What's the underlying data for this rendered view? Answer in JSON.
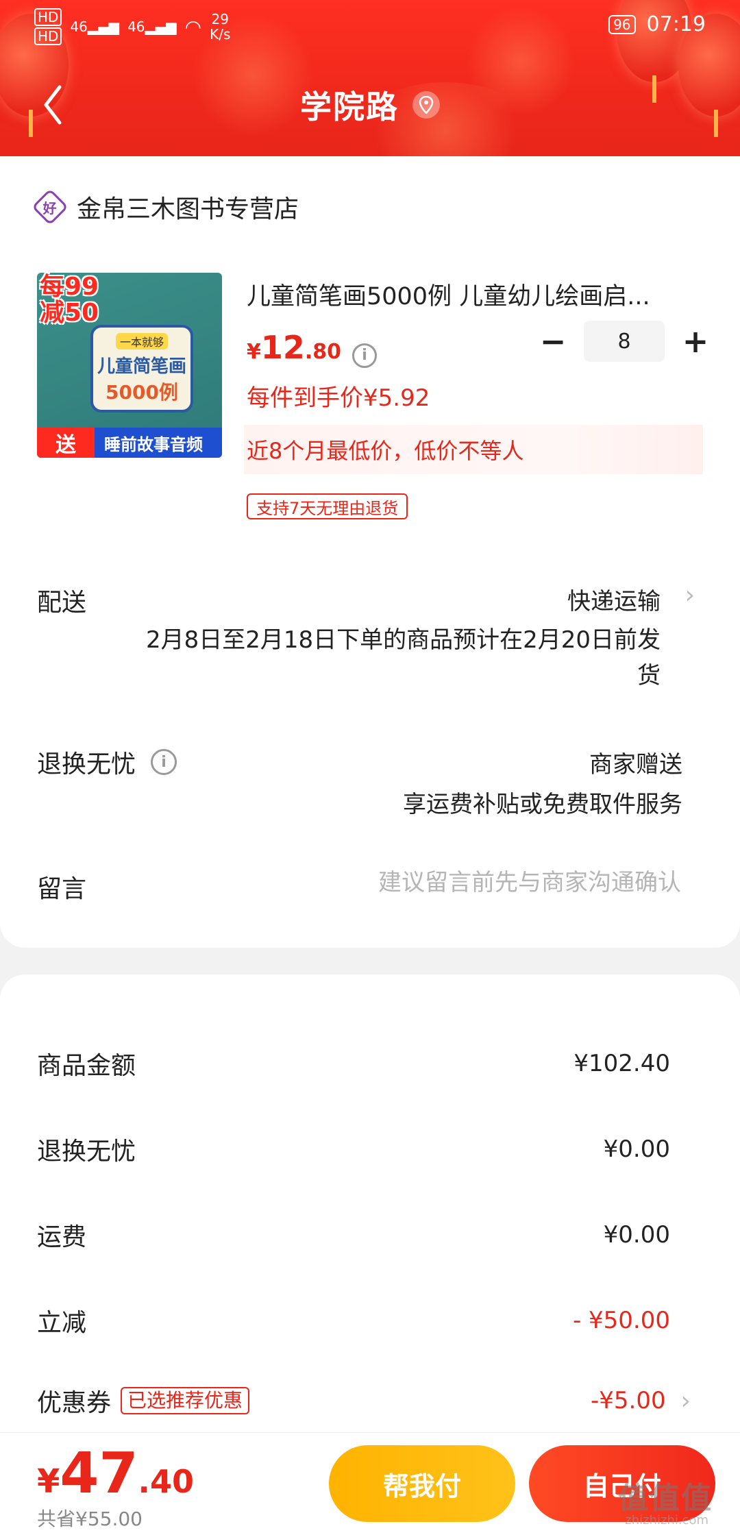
{
  "status_bar": {
    "hd1": "HD",
    "hd2": "HD",
    "signal1": "46",
    "signal2": "46",
    "speed_value": "29",
    "speed_unit": "K/s",
    "battery": "96",
    "time": "07:19"
  },
  "header": {
    "title": "学院路"
  },
  "store": {
    "badge": "好",
    "name": "金帛三木图书专营店"
  },
  "product": {
    "image_promo": "每99减50",
    "image_book_tag": "一本就够",
    "image_book_title": "儿童简笔画",
    "image_book_count": "5000例",
    "image_send": "送",
    "image_audio": "睡前故事音频",
    "title": "儿童简笔画5000例 儿童幼儿绘画启...",
    "price_symbol": "¥",
    "price_int": "12",
    "price_dec": ".80",
    "quantity": "8",
    "minus_label": "−",
    "plus_label": "+",
    "unit_price": "每件到手价¥5.92",
    "low_price_note": "近8个月最低价，低价不等人",
    "return_tag": "支持7天无理由退货"
  },
  "delivery": {
    "label": "配送",
    "method": "快递运输",
    "description": "2月8日至2月18日下单的商品预计在2月20日前发货"
  },
  "worry_free": {
    "label": "退换无忧",
    "gift": "商家赠送",
    "description": "享运费补贴或免费取件服务"
  },
  "message": {
    "label": "留言",
    "placeholder": "建议留言前先与商家沟通确认"
  },
  "summary": {
    "rows": [
      {
        "label": "商品金额",
        "value": "¥102.40"
      },
      {
        "label": "退换无忧",
        "value": "¥0.00"
      },
      {
        "label": "运费",
        "value": "¥0.00"
      },
      {
        "label": "立减",
        "value": "- ¥50.00"
      },
      {
        "label": "优惠券",
        "tag": "已选推荐优惠",
        "value": "-¥5.00"
      }
    ]
  },
  "bottom": {
    "total_symbol": "¥",
    "total_int": "47",
    "total_dec": ".40",
    "saved": "共省¥55.00",
    "help_pay": "帮我付",
    "self_pay": "自己付"
  },
  "watermark": {
    "text": "值值值",
    "sub": "zhizhizhi.com"
  },
  "colors": {
    "accent_red": "#e8261a",
    "accent_yellow": "#ffb300"
  },
  "icons": {
    "back": "back-arrow-icon",
    "location": "location-pin-icon",
    "info": "info-icon",
    "chevron": "chevron-right-icon"
  }
}
